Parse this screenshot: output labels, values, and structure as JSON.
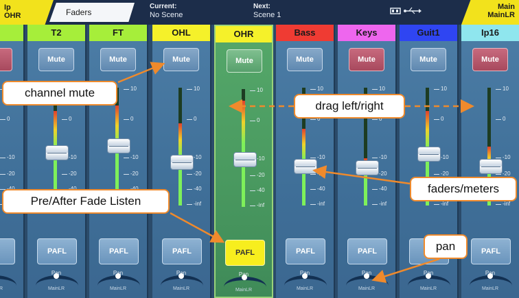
{
  "topbar": {
    "selected_label": "Ip",
    "selected_value": "OHR",
    "tab": "Faders",
    "current_label": "Current:",
    "current_value": "No Scene",
    "next_label": "Next:",
    "next_value": "Scene 1",
    "usb_icon": "usb-icon",
    "main_label": "Main",
    "main_value": "MainLR"
  },
  "channels": [
    {
      "name": "",
      "color": "#a6ee3a",
      "mute": "",
      "mute_state": "active",
      "pafl": "L"
    },
    {
      "name": "T2",
      "color": "#a6ee3a",
      "mute": "Mute",
      "mute_state": "normal",
      "pafl": "PAFL"
    },
    {
      "name": "FT",
      "color": "#a6ee3a",
      "mute": "Mute",
      "mute_state": "normal",
      "pafl": "PAFL"
    },
    {
      "name": "OHL",
      "color": "#f5f12a",
      "mute": "Mute",
      "mute_state": "normal",
      "pafl": "PAFL"
    },
    {
      "name": "OHR",
      "color": "#f5f12a",
      "mute": "Mute",
      "mute_state": "selected",
      "pafl": "PAFL"
    },
    {
      "name": "Bass",
      "color": "#ef3b33",
      "mute": "Mute",
      "mute_state": "normal",
      "pafl": "PAFL"
    },
    {
      "name": "Keys",
      "color": "#ee66ee",
      "mute": "Mute",
      "mute_state": "active",
      "pafl": "PAFL"
    },
    {
      "name": "Guit1",
      "color": "#2f45f2",
      "mute": "Mute",
      "mute_state": "normal",
      "pafl": "P"
    },
    {
      "name": "Ip16",
      "color": "#8fe6ee",
      "mute": "Mute",
      "mute_state": "active",
      "pafl": "PAFL"
    }
  ],
  "scale": {
    "top": "10",
    "zero": "0",
    "m10": "-10",
    "m20": "-20",
    "m40": "-40",
    "inf": "-inf"
  },
  "pan_label": "Pan",
  "pan_dest": "MainLR",
  "callouts": {
    "mute": "channel mute",
    "drag": "drag left/right",
    "faders": "faders/meters",
    "pafl": "Pre/After Fade Listen",
    "pan": "pan"
  },
  "accent": {
    "callout_border": "#ef8a2c",
    "pafl_on": "#f7ee1e",
    "selected_strip": "#4a9a60"
  }
}
